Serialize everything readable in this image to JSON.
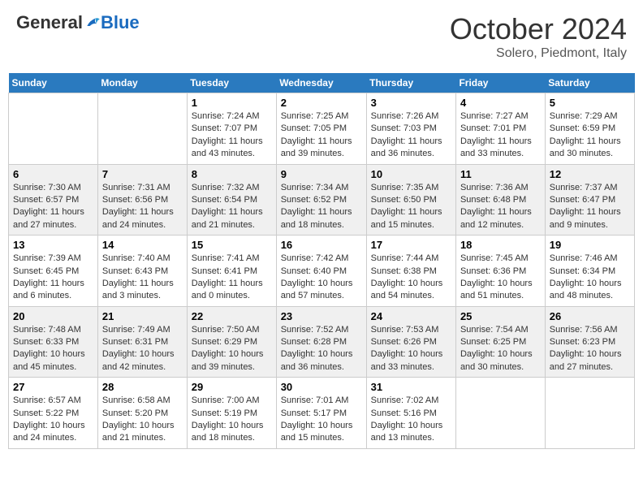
{
  "header": {
    "logo_general": "General",
    "logo_blue": "Blue",
    "month_title": "October 2024",
    "location": "Solero, Piedmont, Italy"
  },
  "weekdays": [
    "Sunday",
    "Monday",
    "Tuesday",
    "Wednesday",
    "Thursday",
    "Friday",
    "Saturday"
  ],
  "weeks": [
    [
      null,
      null,
      {
        "day": "1",
        "sunrise": "7:24 AM",
        "sunset": "7:07 PM",
        "daylight": "11 hours and 43 minutes."
      },
      {
        "day": "2",
        "sunrise": "7:25 AM",
        "sunset": "7:05 PM",
        "daylight": "11 hours and 39 minutes."
      },
      {
        "day": "3",
        "sunrise": "7:26 AM",
        "sunset": "7:03 PM",
        "daylight": "11 hours and 36 minutes."
      },
      {
        "day": "4",
        "sunrise": "7:27 AM",
        "sunset": "7:01 PM",
        "daylight": "11 hours and 33 minutes."
      },
      {
        "day": "5",
        "sunrise": "7:29 AM",
        "sunset": "6:59 PM",
        "daylight": "11 hours and 30 minutes."
      }
    ],
    [
      {
        "day": "6",
        "sunrise": "7:30 AM",
        "sunset": "6:57 PM",
        "daylight": "11 hours and 27 minutes."
      },
      {
        "day": "7",
        "sunrise": "7:31 AM",
        "sunset": "6:56 PM",
        "daylight": "11 hours and 24 minutes."
      },
      {
        "day": "8",
        "sunrise": "7:32 AM",
        "sunset": "6:54 PM",
        "daylight": "11 hours and 21 minutes."
      },
      {
        "day": "9",
        "sunrise": "7:34 AM",
        "sunset": "6:52 PM",
        "daylight": "11 hours and 18 minutes."
      },
      {
        "day": "10",
        "sunrise": "7:35 AM",
        "sunset": "6:50 PM",
        "daylight": "11 hours and 15 minutes."
      },
      {
        "day": "11",
        "sunrise": "7:36 AM",
        "sunset": "6:48 PM",
        "daylight": "11 hours and 12 minutes."
      },
      {
        "day": "12",
        "sunrise": "7:37 AM",
        "sunset": "6:47 PM",
        "daylight": "11 hours and 9 minutes."
      }
    ],
    [
      {
        "day": "13",
        "sunrise": "7:39 AM",
        "sunset": "6:45 PM",
        "daylight": "11 hours and 6 minutes."
      },
      {
        "day": "14",
        "sunrise": "7:40 AM",
        "sunset": "6:43 PM",
        "daylight": "11 hours and 3 minutes."
      },
      {
        "day": "15",
        "sunrise": "7:41 AM",
        "sunset": "6:41 PM",
        "daylight": "11 hours and 0 minutes."
      },
      {
        "day": "16",
        "sunrise": "7:42 AM",
        "sunset": "6:40 PM",
        "daylight": "10 hours and 57 minutes."
      },
      {
        "day": "17",
        "sunrise": "7:44 AM",
        "sunset": "6:38 PM",
        "daylight": "10 hours and 54 minutes."
      },
      {
        "day": "18",
        "sunrise": "7:45 AM",
        "sunset": "6:36 PM",
        "daylight": "10 hours and 51 minutes."
      },
      {
        "day": "19",
        "sunrise": "7:46 AM",
        "sunset": "6:34 PM",
        "daylight": "10 hours and 48 minutes."
      }
    ],
    [
      {
        "day": "20",
        "sunrise": "7:48 AM",
        "sunset": "6:33 PM",
        "daylight": "10 hours and 45 minutes."
      },
      {
        "day": "21",
        "sunrise": "7:49 AM",
        "sunset": "6:31 PM",
        "daylight": "10 hours and 42 minutes."
      },
      {
        "day": "22",
        "sunrise": "7:50 AM",
        "sunset": "6:29 PM",
        "daylight": "10 hours and 39 minutes."
      },
      {
        "day": "23",
        "sunrise": "7:52 AM",
        "sunset": "6:28 PM",
        "daylight": "10 hours and 36 minutes."
      },
      {
        "day": "24",
        "sunrise": "7:53 AM",
        "sunset": "6:26 PM",
        "daylight": "10 hours and 33 minutes."
      },
      {
        "day": "25",
        "sunrise": "7:54 AM",
        "sunset": "6:25 PM",
        "daylight": "10 hours and 30 minutes."
      },
      {
        "day": "26",
        "sunrise": "7:56 AM",
        "sunset": "6:23 PM",
        "daylight": "10 hours and 27 minutes."
      }
    ],
    [
      {
        "day": "27",
        "sunrise": "6:57 AM",
        "sunset": "5:22 PM",
        "daylight": "10 hours and 24 minutes."
      },
      {
        "day": "28",
        "sunrise": "6:58 AM",
        "sunset": "5:20 PM",
        "daylight": "10 hours and 21 minutes."
      },
      {
        "day": "29",
        "sunrise": "7:00 AM",
        "sunset": "5:19 PM",
        "daylight": "10 hours and 18 minutes."
      },
      {
        "day": "30",
        "sunrise": "7:01 AM",
        "sunset": "5:17 PM",
        "daylight": "10 hours and 15 minutes."
      },
      {
        "day": "31",
        "sunrise": "7:02 AM",
        "sunset": "5:16 PM",
        "daylight": "10 hours and 13 minutes."
      },
      null,
      null
    ]
  ],
  "labels": {
    "sunrise": "Sunrise:",
    "sunset": "Sunset:",
    "daylight": "Daylight:"
  }
}
